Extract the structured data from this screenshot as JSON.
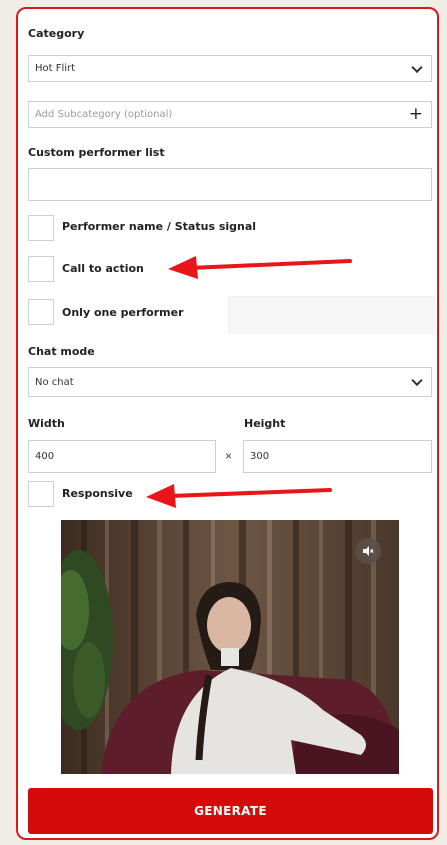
{
  "category": {
    "label": "Category",
    "value": "Hot Flirt"
  },
  "subcategory": {
    "placeholder": "Add Subcategory (optional)"
  },
  "custom_performer_list": {
    "label": "Custom performer list",
    "value": ""
  },
  "options": {
    "performer_name": "Performer name / Status signal",
    "call_to_action": "Call to action",
    "only_one_performer": "Only one performer"
  },
  "chat_mode": {
    "label": "Chat mode",
    "value": "No chat"
  },
  "dimensions": {
    "width_label": "Width",
    "height_label": "Height",
    "width_value": "400",
    "height_value": "300",
    "separator": "×"
  },
  "responsive": {
    "label": "Responsive"
  },
  "generate_label": "GENERATE",
  "colors": {
    "accent": "#d50a0a",
    "annotation_arrow": "#e8161a"
  },
  "icons": {
    "select_chevron": "chevron-down-icon",
    "add": "plus-icon",
    "mute": "speaker-mute-icon"
  }
}
